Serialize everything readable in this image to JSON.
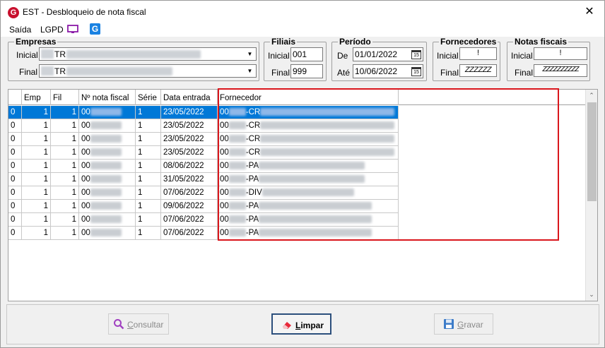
{
  "window": {
    "title": "EST - Desbloqueio de nota fiscal",
    "close_glyph": "✕"
  },
  "menu": {
    "items": [
      "Saída",
      "LGPD"
    ]
  },
  "empresas": {
    "legend": "Empresas",
    "inicial_label": "Inicial",
    "inicial_value": "TR",
    "final_label": "Final",
    "final_value": "TR"
  },
  "filiais": {
    "legend": "Filiais",
    "inicial_label": "Inicial",
    "inicial_value": "001",
    "final_label": "Final",
    "final_value": "999"
  },
  "periodo": {
    "legend": "Período",
    "de_label": "De",
    "de_value": "01/01/2022",
    "ate_label": "Até",
    "ate_value": "10/06/2022",
    "cal_glyph": "15"
  },
  "fornecedores": {
    "legend": "Fornecedores",
    "inicial_label": "Inicial",
    "inicial_value": "!",
    "final_label": "Final",
    "final_value": "ZZZZZZ"
  },
  "notas": {
    "legend": "Notas fiscais",
    "inicial_label": "Inicial",
    "inicial_value": "!",
    "final_label": "Final",
    "final_value": "ZZZZZZZZZZ"
  },
  "grid": {
    "columns": [
      "Emp",
      "Fil",
      "Nº nota fiscal",
      "Série",
      "Data entrada",
      "Fornecedor"
    ],
    "rows": [
      {
        "c0": "0",
        "emp": "1",
        "fil": "1",
        "nf": "00",
        "serie": "1",
        "data": "23/05/2022",
        "forn_code": "00",
        "forn_name": "-CR"
      },
      {
        "c0": "0",
        "emp": "1",
        "fil": "1",
        "nf": "00",
        "serie": "1",
        "data": "23/05/2022",
        "forn_code": "00",
        "forn_name": "-CR"
      },
      {
        "c0": "0",
        "emp": "1",
        "fil": "1",
        "nf": "00",
        "serie": "1",
        "data": "23/05/2022",
        "forn_code": "00",
        "forn_name": "-CR"
      },
      {
        "c0": "0",
        "emp": "1",
        "fil": "1",
        "nf": "00",
        "serie": "1",
        "data": "23/05/2022",
        "forn_code": "00",
        "forn_name": "-CR"
      },
      {
        "c0": "0",
        "emp": "1",
        "fil": "1",
        "nf": "00",
        "serie": "1",
        "data": "08/06/2022",
        "forn_code": "00",
        "forn_name": "-PA"
      },
      {
        "c0": "0",
        "emp": "1",
        "fil": "1",
        "nf": "00",
        "serie": "1",
        "data": "31/05/2022",
        "forn_code": "00",
        "forn_name": "-PA"
      },
      {
        "c0": "0",
        "emp": "1",
        "fil": "1",
        "nf": "00",
        "serie": "1",
        "data": "07/06/2022",
        "forn_code": "00",
        "forn_name": "-DIV"
      },
      {
        "c0": "0",
        "emp": "1",
        "fil": "1",
        "nf": "00",
        "serie": "1",
        "data": "09/06/2022",
        "forn_code": "00",
        "forn_name": "-PA"
      },
      {
        "c0": "0",
        "emp": "1",
        "fil": "1",
        "nf": "00",
        "serie": "1",
        "data": "07/06/2022",
        "forn_code": "00",
        "forn_name": "-PA"
      },
      {
        "c0": "0",
        "emp": "1",
        "fil": "1",
        "nf": "00",
        "serie": "1",
        "data": "07/06/2022",
        "forn_code": "00",
        "forn_name": "-PA"
      }
    ]
  },
  "buttons": {
    "consultar": {
      "label_first": "C",
      "label_rest": "onsultar"
    },
    "limpar": {
      "label_first": "L",
      "label_rest": "impar"
    },
    "gravar": {
      "label_first": "G",
      "label_rest": "ravar"
    }
  },
  "colors": {
    "accent": "#0078d7",
    "highlight_border": "#d9161c",
    "logo": "#c8102e",
    "g_logo": "#1a82e2"
  }
}
